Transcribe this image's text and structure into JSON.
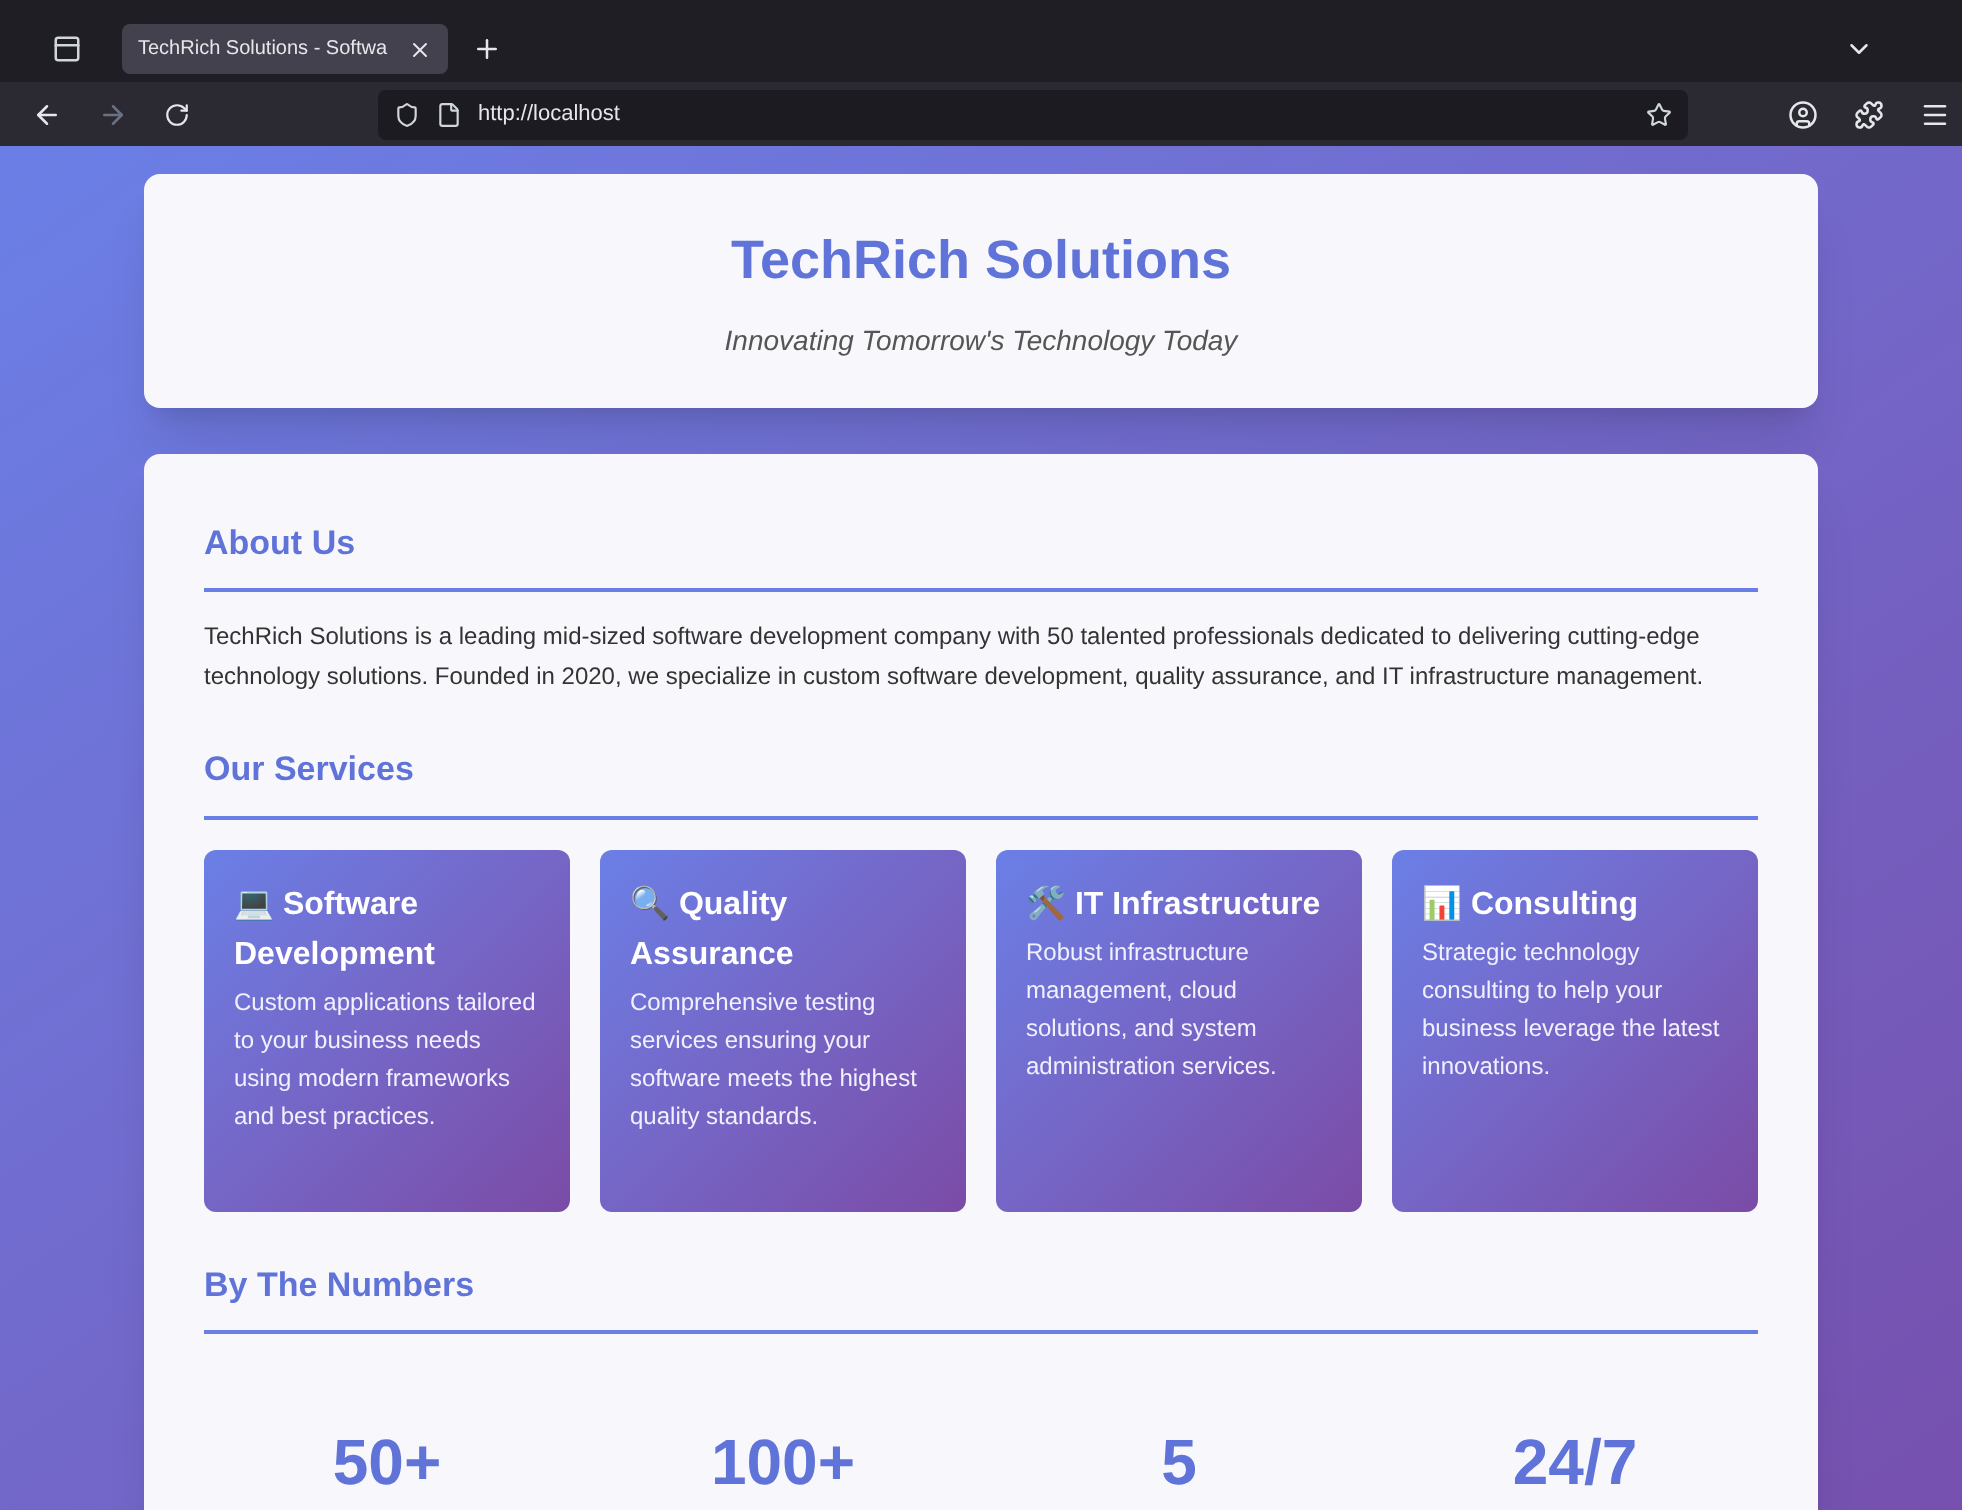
{
  "browser": {
    "tab": {
      "title": "TechRich Solutions - Softwa",
      "selected": true
    },
    "address": "http://localhost"
  },
  "header": {
    "title": "TechRich Solutions",
    "tagline": "Innovating Tomorrow's Technology Today"
  },
  "about": {
    "heading": "About Us",
    "text": "TechRich Solutions is a leading mid-sized software development company with 50 talented professionals dedicated to delivering cutting-edge technology solutions. Founded in 2020, we specialize in custom software development, quality assurance, and IT infrastructure management."
  },
  "services": {
    "heading": "Our Services",
    "items": [
      {
        "title": "💻 Software Development",
        "text": "Custom applications tailored to your business needs using modern frameworks and best practices."
      },
      {
        "title": "🔍 Quality Assurance",
        "text": "Comprehensive testing services ensuring your software meets the highest quality standards."
      },
      {
        "title": "🛠️ IT Infrastructure",
        "text": "Robust infrastructure management, cloud solutions, and system administration services."
      },
      {
        "title": "📊 Consulting",
        "text": "Strategic technology consulting to help your business leverage the latest innovations."
      }
    ]
  },
  "numbers": {
    "heading": "By The Numbers",
    "items": [
      "50+",
      "100+",
      "5",
      "24/7"
    ]
  }
}
